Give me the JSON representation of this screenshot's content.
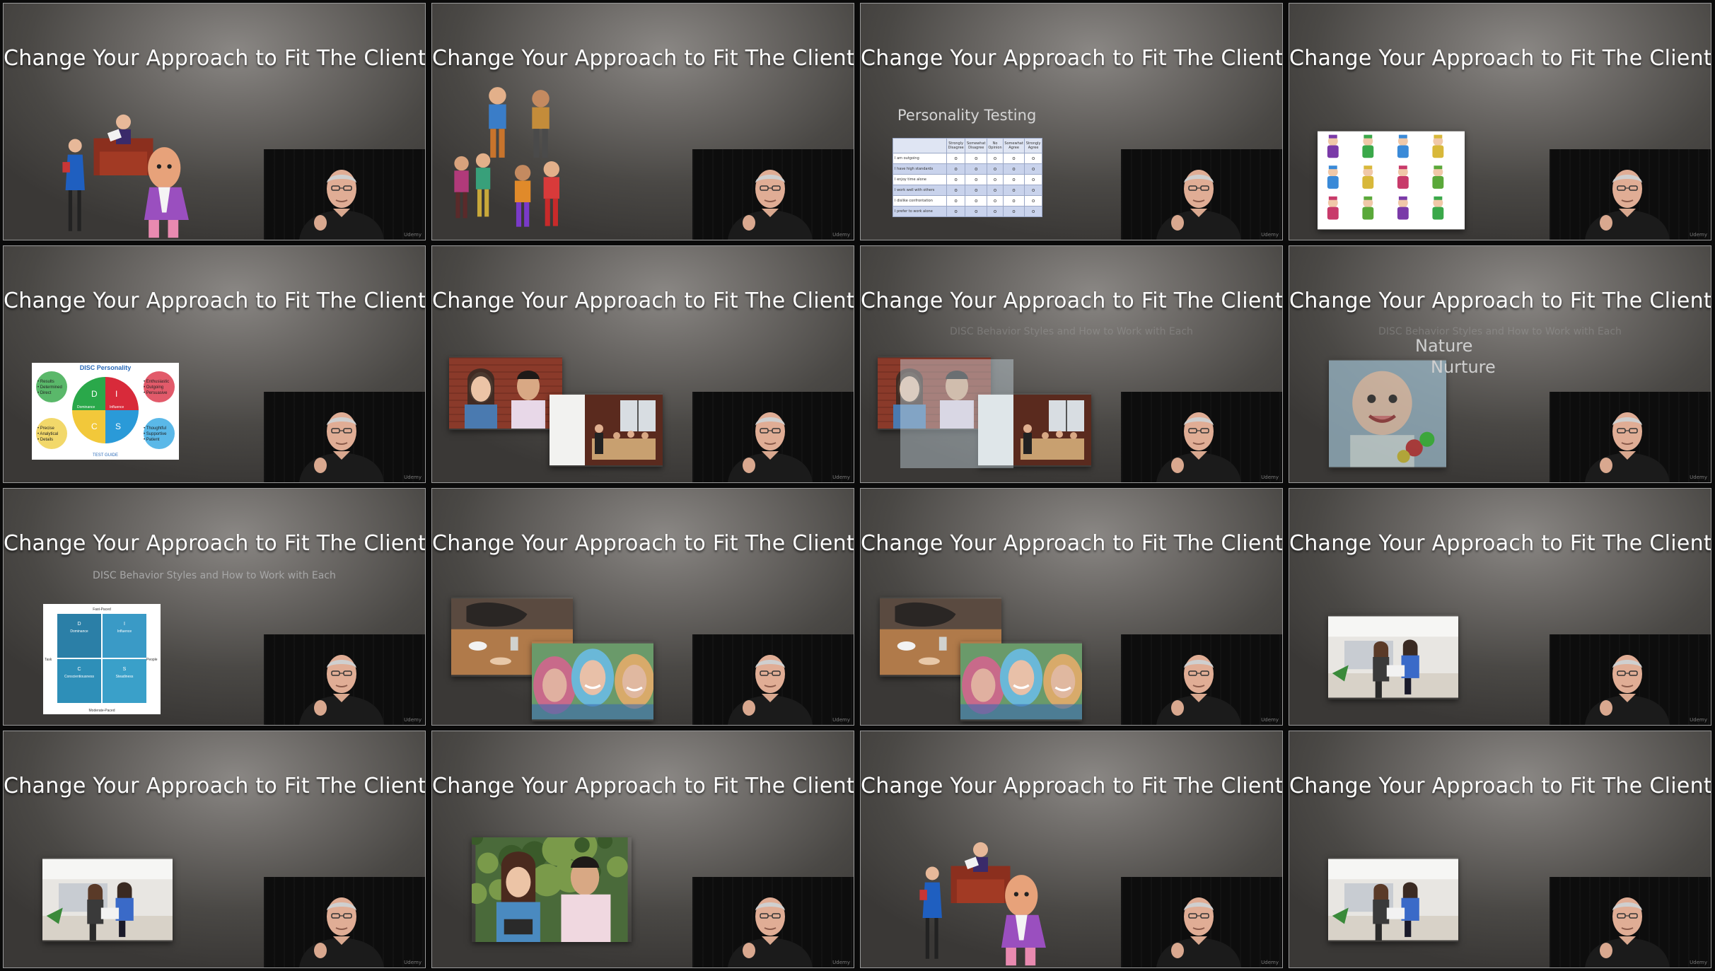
{
  "thumbnails": [
    {
      "index": 1,
      "title": "Change Your Approach to Fit The Client",
      "scene": "office-cartoon"
    },
    {
      "index": 2,
      "title": "Change Your Approach to Fit The Client",
      "scene": "cartoon-people-group"
    },
    {
      "index": 3,
      "title": "Change Your Approach to Fit The Client",
      "scene": "personality-table"
    },
    {
      "index": 4,
      "title": "Change Your Approach to Fit The Client",
      "scene": "character-grid"
    },
    {
      "index": 5,
      "title": "Change Your Approach to Fit The Client",
      "scene": "disc-personality"
    },
    {
      "index": 6,
      "title": "Change Your Approach to Fit The Client",
      "scene": "photo-pair"
    },
    {
      "index": 7,
      "title": "Change Your Approach to Fit The Client",
      "scene": "photo-pair-faded",
      "subtitle": "DISC Behavior Styles and How to Work with Each"
    },
    {
      "index": 8,
      "title": "Change Your Approach to Fit The Client",
      "scene": "nature-baby",
      "subtitle": "DISC Behavior Styles and How to Work with Each"
    },
    {
      "index": 9,
      "title": "Change Your Approach to Fit The Client",
      "scene": "disc-chart",
      "subtitle": "DISC Behavior Styles and How to Work with Each"
    },
    {
      "index": 10,
      "title": "Change Your Approach to Fit The Client",
      "scene": "cafe-and-friends"
    },
    {
      "index": 11,
      "title": "Change Your Approach to Fit The Client",
      "scene": "cafe-and-friends"
    },
    {
      "index": 12,
      "title": "Change Your Approach to Fit The Client",
      "scene": "two-women-office"
    },
    {
      "index": 13,
      "title": "Change Your Approach to Fit The Client",
      "scene": "two-women-office-small"
    },
    {
      "index": 14,
      "title": "Change Your Approach to Fit The Client",
      "scene": "two-people-outdoor"
    },
    {
      "index": 15,
      "title": "Change Your Approach to Fit The Client",
      "scene": "office-cartoon"
    },
    {
      "index": 16,
      "title": "Change Your Approach to Fit The Client",
      "scene": "two-women-office"
    }
  ],
  "personality_testing": {
    "label": "Personality Testing",
    "columns": [
      "",
      "Strongly Disagree",
      "Somewhat Disagree",
      "No Opinion",
      "Somewhat Agree",
      "Strongly Agree"
    ],
    "rows": [
      "I am outgoing",
      "I have high standards",
      "I enjoy time alone",
      "I work well with others",
      "I dislike confrontation",
      "I prefer to work alone"
    ],
    "mark": "o"
  },
  "disc_personality": {
    "title": "DISC Personality",
    "tl": [
      "• Results",
      "• Determined",
      "• Direct"
    ],
    "tr": [
      "• Enthusiastic",
      "• Outgoing",
      "• Persuasive"
    ],
    "bl": [
      "• Precise",
      "• Analytical",
      "• Details"
    ],
    "br": [
      "• Thoughtful",
      "• Supportive",
      "• Patient"
    ],
    "letters": [
      "D",
      "I",
      "C",
      "S"
    ],
    "mid_labels": [
      "Dominance",
      "Influence"
    ],
    "footer": "TEST GUIDE"
  },
  "disc_chart": {
    "top": "Fast-Paced",
    "bottom": "Moderate-Paced",
    "left": "Task",
    "right": "People",
    "quadrants": [
      {
        "letter": "D",
        "name": "Dominance",
        "color": "#2b7fa7"
      },
      {
        "letter": "I",
        "name": "Influence",
        "color": "#3a9ac6"
      },
      {
        "letter": "C",
        "name": "Conscientiousness",
        "color": "#2e8fb8"
      },
      {
        "letter": "S",
        "name": "Steadiness",
        "color": "#3aa0c9"
      }
    ]
  },
  "nature_nurture": {
    "nature": "Nature",
    "nurture": "Nurture"
  },
  "watermark": "Udemy",
  "colors": {
    "title": "#ffffff",
    "background_center": "#8a8784",
    "background_edge": "#3a3836",
    "video_bg": "#0d0d0d"
  }
}
